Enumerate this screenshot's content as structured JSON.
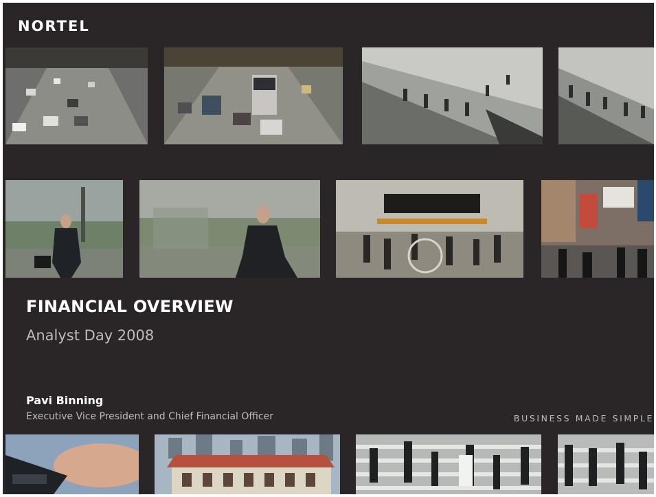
{
  "brand": {
    "logo_text": "NORTEL"
  },
  "slide": {
    "title": "FINANCIAL OVERVIEW",
    "subtitle": "Analyst Day 2008",
    "presenter_name": "Pavi Binning",
    "presenter_role": "Executive Vice President and Chief Financial Officer",
    "tagline": "BUSINESS MADE SIMPLE"
  },
  "photos": {
    "row1": [
      "city-traffic-photo",
      "city-traffic-bus-photo",
      "escalator-crowd-photo",
      "escalator-crowd-photo-2"
    ],
    "row2": [
      "businessman-running-photo",
      "businessman-running-blur-photo",
      "train-station-concourse-photo",
      "city-street-crowd-photo"
    ],
    "row3": [
      "handheld-device-photo",
      "city-buildings-photo",
      "crosswalk-crowd-photo",
      "crosswalk-crowd-photo-2"
    ]
  },
  "colors": {
    "background": "#2a2627",
    "text_primary": "#ffffff",
    "text_secondary": "#bdbbbc"
  }
}
